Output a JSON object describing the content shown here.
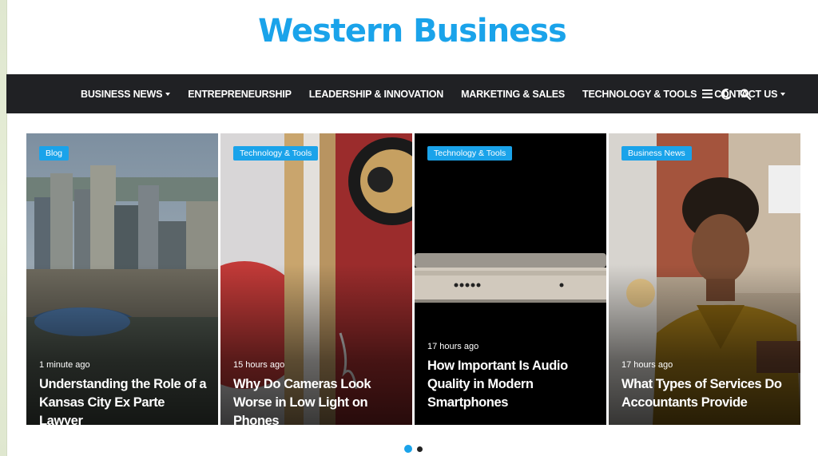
{
  "site": {
    "title": "Western Business",
    "accent": "#1aa3ea"
  },
  "nav": {
    "items": [
      {
        "label": "BUSINESS NEWS",
        "dropdown": true
      },
      {
        "label": "ENTREPRENEURSHIP",
        "dropdown": false
      },
      {
        "label": "LEADERSHIP & INNOVATION",
        "dropdown": false
      },
      {
        "label": "MARKETING & SALES",
        "dropdown": false
      },
      {
        "label": "TECHNOLOGY & TOOLS",
        "dropdown": false
      },
      {
        "label": "CONTACT US",
        "dropdown": true
      }
    ],
    "icons": [
      "menu-icon",
      "moon-icon",
      "search-icon"
    ]
  },
  "slides": [
    {
      "category": "Blog",
      "time": "1 minute ago",
      "title": "Understanding the Role of a Kansas City Ex Parte Lawyer"
    },
    {
      "category": "Technology & Tools",
      "time": "15 hours ago",
      "title": "Why Do Cameras Look Worse in Low Light on Phones"
    },
    {
      "category": "Technology & Tools",
      "time": "17 hours ago",
      "title": "How Important Is Audio Quality in Modern Smartphones"
    },
    {
      "category": "Business News",
      "time": "17 hours ago",
      "title": "What Types of Services Do Accountants Provide"
    }
  ],
  "pagination": {
    "active_color": "#1aa3ea",
    "inactive_color": "#222222"
  }
}
